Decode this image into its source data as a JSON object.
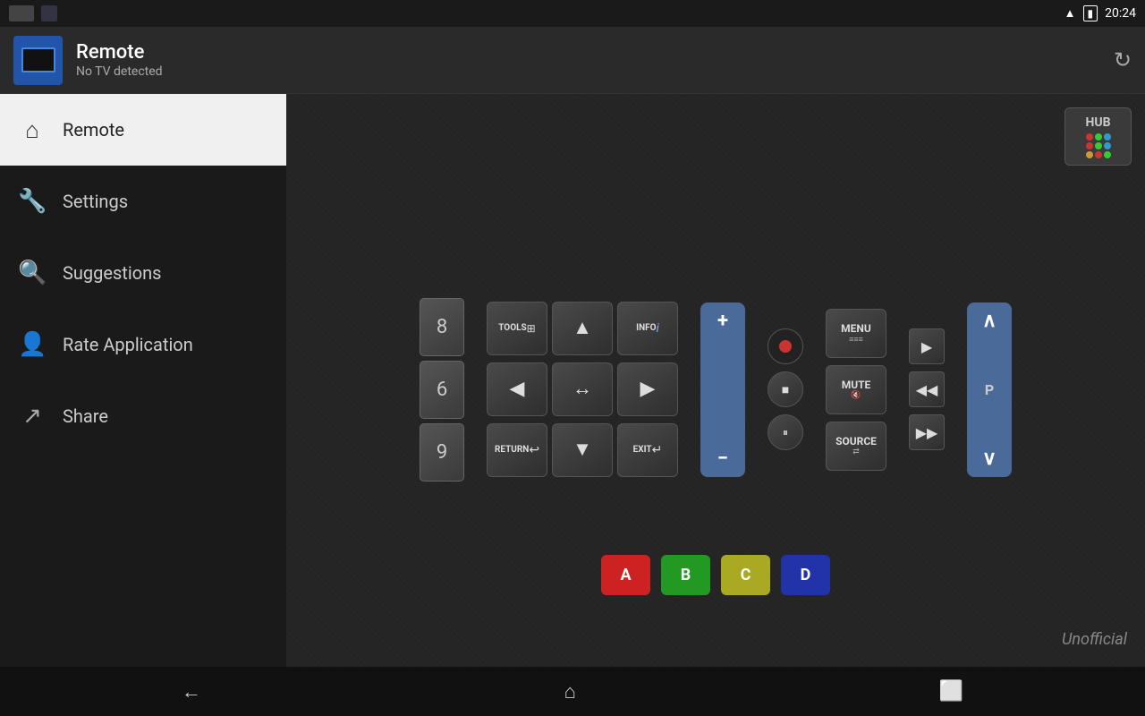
{
  "status_bar": {
    "time": "20:24",
    "wifi": "▲",
    "battery": "▮▮▮"
  },
  "app_header": {
    "title": "Remote",
    "subtitle": "No TV detected",
    "refresh_label": "↻"
  },
  "sidebar": {
    "items": [
      {
        "id": "remote",
        "label": "Remote",
        "icon": "⌂",
        "active": true
      },
      {
        "id": "settings",
        "label": "Settings",
        "icon": "🔧",
        "active": false
      },
      {
        "id": "suggestions",
        "label": "Suggestions",
        "icon": "🔍",
        "active": false
      },
      {
        "id": "rate",
        "label": "Rate Application",
        "icon": "👤",
        "active": false
      },
      {
        "id": "share",
        "label": "Share",
        "icon": "↗",
        "active": false
      }
    ]
  },
  "remote": {
    "hub_label": "HUB",
    "hub_colors": [
      "#cc3333",
      "#33cc33",
      "#cccc33",
      "#3333cc",
      "#cc3333",
      "#33cc33",
      "#cccc33",
      "#3333cc",
      "#cc6633"
    ],
    "num_buttons": [
      "8",
      "6",
      "9"
    ],
    "tools_label": "TOOLS",
    "tools_icon": "⊞",
    "info_label": "INFO",
    "info_icon": "i",
    "up_label": "▲",
    "left_label": "◀",
    "ok_label": "↔",
    "right_label": "▶",
    "down_label": "▼",
    "return_label": "RETURN",
    "return_icon": "↩",
    "exit_label": "EXIT",
    "exit_icon": "↵",
    "vol_plus": "+",
    "vol_minus": "−",
    "ch_plus": "P",
    "ch_minus": "∨",
    "ch_up_icon": "∧",
    "rec_label": "●",
    "stop_label": "■",
    "pause_label": "⏸",
    "menu_label": "MENU",
    "mute_label": "MUTE",
    "source_label": "SOURCE",
    "play_label": "▶",
    "rew_label": "◀◀",
    "ff_label": "▶▶",
    "color_buttons": [
      {
        "label": "A",
        "color": "#cc2222"
      },
      {
        "label": "B",
        "color": "#229922"
      },
      {
        "label": "C",
        "color": "#aaaa22"
      },
      {
        "label": "D",
        "color": "#2233aa"
      }
    ],
    "watermark": "Unofficial"
  },
  "nav_bar": {
    "back_label": "←",
    "home_label": "⌂",
    "recent_label": "⬜"
  }
}
